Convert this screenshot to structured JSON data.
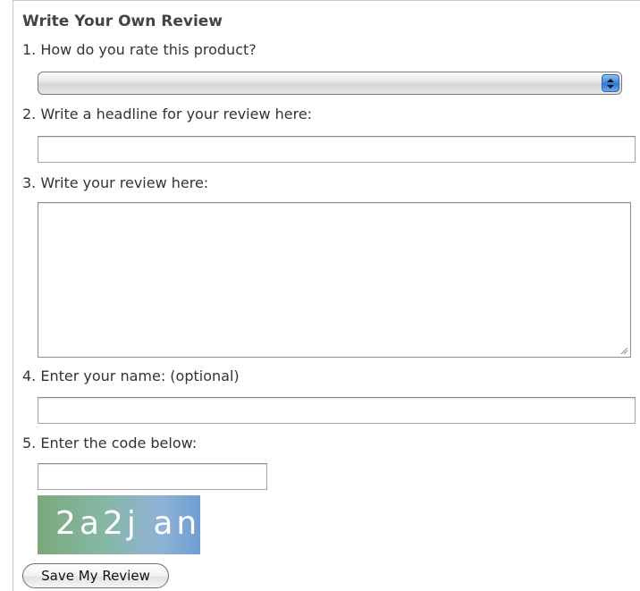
{
  "form": {
    "heading": "Write Your Own Review",
    "q1_label": "1. How do you rate this product?",
    "q1_selected": "",
    "q2_label": "2. Write a headline for your review here:",
    "q2_value": "",
    "q3_label": "3. Write your review here:",
    "q3_value": "",
    "q4_label": "4. Enter your name: (optional)",
    "q4_value": "",
    "q5_label": "5. Enter the code below:",
    "q5_value": "",
    "captcha_code": "2a2j an",
    "save_label": "Save My Review"
  },
  "colors": {
    "frame_border": "#b8cde0",
    "select_arrow_accent": "#3b84e0"
  },
  "icons": {
    "select_arrows": "updown-arrows-icon",
    "resize_grip": "resize-grip-icon"
  }
}
